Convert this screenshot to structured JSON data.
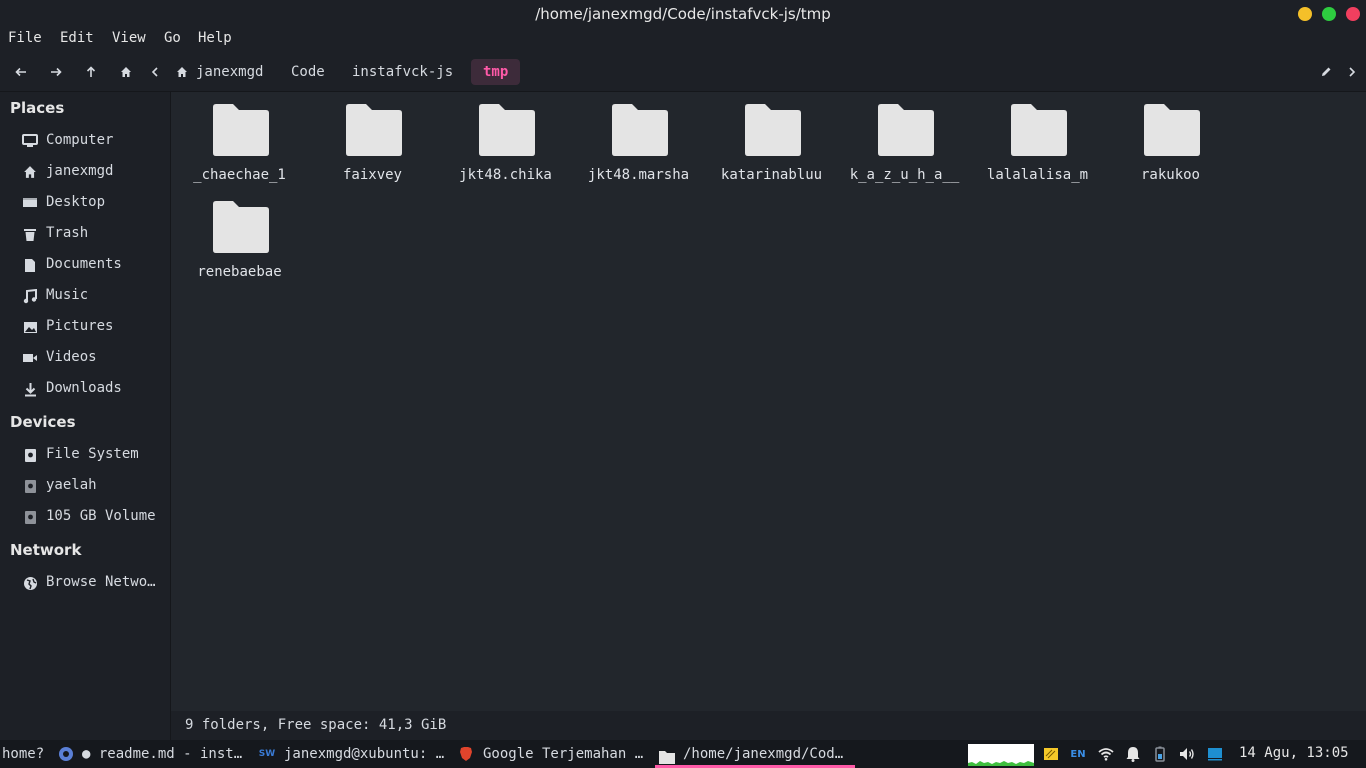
{
  "window": {
    "title": "/home/janexmgd/Code/instafvck-js/tmp"
  },
  "menu": [
    "File",
    "Edit",
    "View",
    "Go",
    "Help"
  ],
  "toolbar": {
    "breadcrumbs": [
      "janexmgd",
      "Code",
      "instafvck-js",
      "tmp"
    ]
  },
  "sidebar": {
    "places_title": "Places",
    "places": [
      {
        "label": "Computer",
        "icon": "monitor-icon"
      },
      {
        "label": "janexmgd",
        "icon": "home-icon"
      },
      {
        "label": "Desktop",
        "icon": "desktop-icon"
      },
      {
        "label": "Trash",
        "icon": "trash-icon"
      },
      {
        "label": "Documents",
        "icon": "document-icon"
      },
      {
        "label": "Music",
        "icon": "music-icon"
      },
      {
        "label": "Pictures",
        "icon": "picture-icon"
      },
      {
        "label": "Videos",
        "icon": "video-icon"
      },
      {
        "label": "Downloads",
        "icon": "download-icon"
      }
    ],
    "devices_title": "Devices",
    "devices": [
      {
        "label": "File System",
        "icon": "drive-icon"
      },
      {
        "label": "yaelah",
        "icon": "drive-icon"
      },
      {
        "label": "105 GB Volume",
        "icon": "drive-icon"
      }
    ],
    "network_title": "Network",
    "network": [
      {
        "label": "Browse Netwo…",
        "icon": "globe-icon"
      }
    ]
  },
  "folders": [
    "_chaechae_1",
    "faixvey",
    "jkt48.chika",
    "jkt48.marsha",
    "katarinabluu",
    "k_a_z_u_h_a__",
    "lalalalisa_m",
    "rakukoo",
    "renebaebae"
  ],
  "status": "9 folders, Free space: 41,3 GiB",
  "taskbar": {
    "tasks": [
      "home?",
      "● readme.md - inst…",
      "janexmgd@xubuntu: …",
      "Google Terjemahan …",
      "/home/janexmgd/Cod…"
    ],
    "lang": "EN",
    "clock": "14 Agu, 13:05"
  },
  "colors": {
    "accent": "#ff5aa8",
    "background": "#22262c",
    "panel": "#1d2026",
    "folder": "#e4e4e4"
  }
}
